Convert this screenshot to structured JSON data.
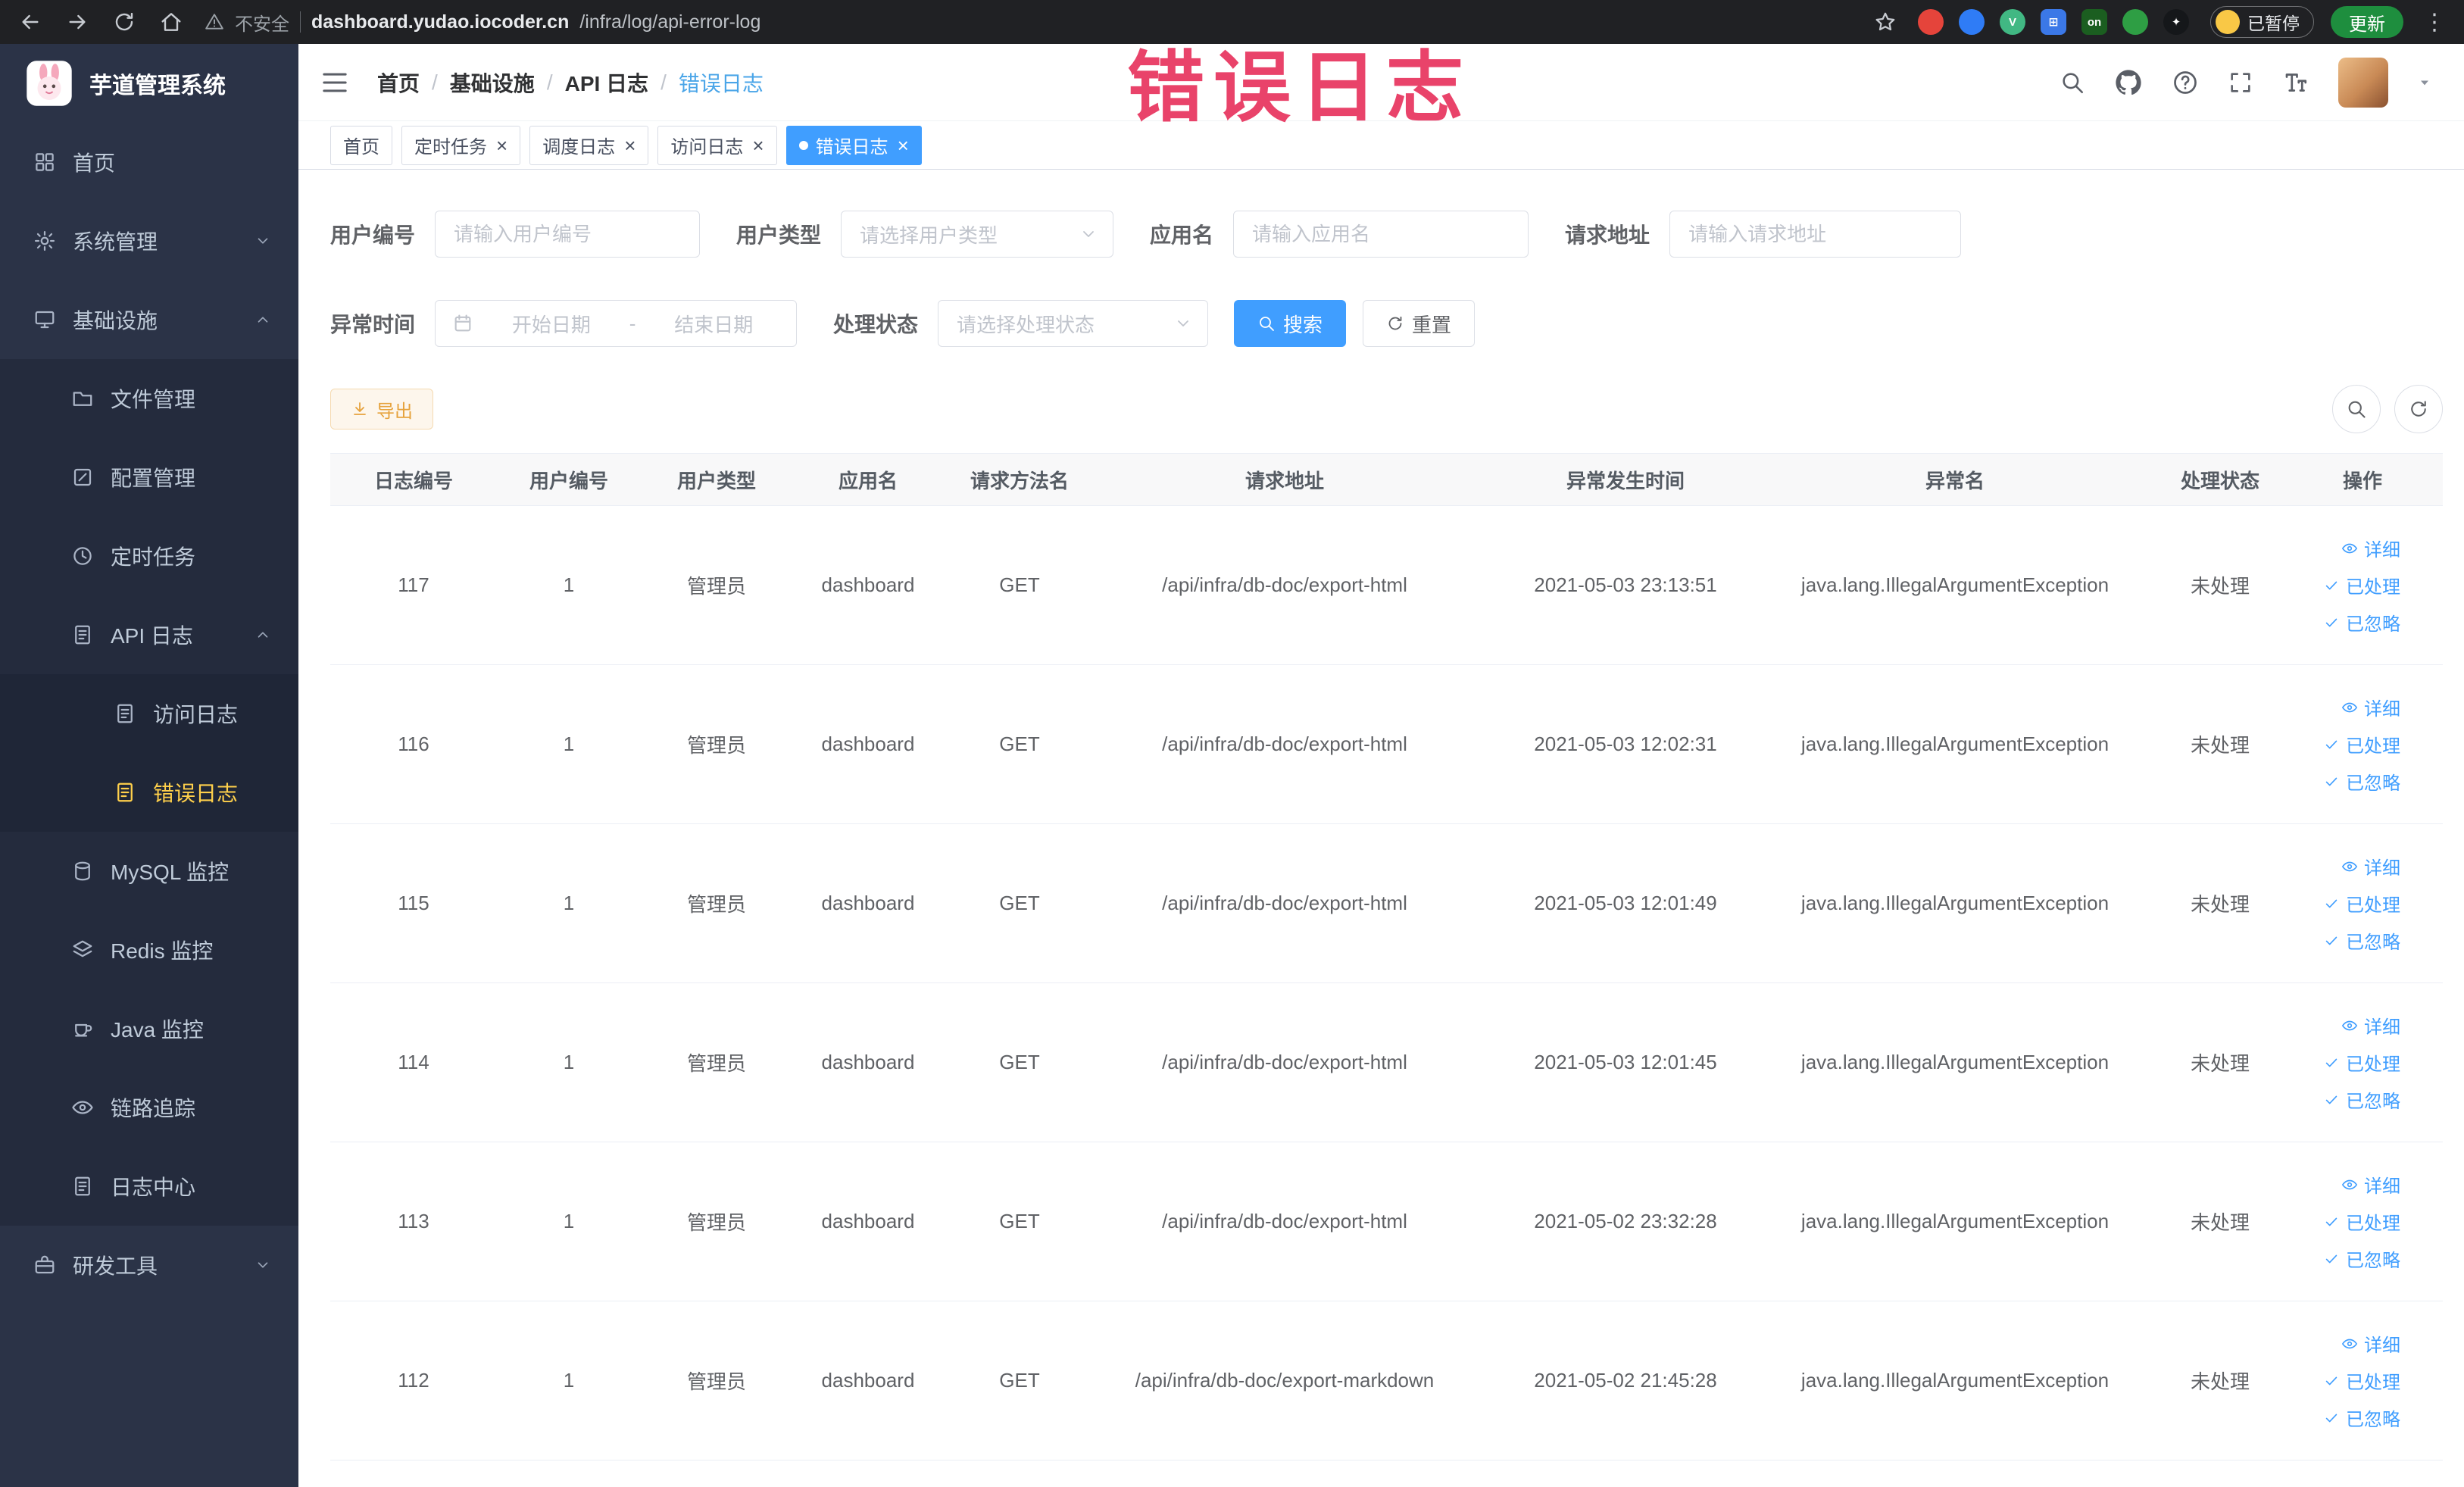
{
  "colors": {
    "accent": "#409eff",
    "link": "#409eff",
    "annotation": "#e8345e",
    "warning": "#e6a23c",
    "sidebar_active": "#ffd04b"
  },
  "annotation": {
    "text": "错误日志"
  },
  "browser": {
    "security_label": "不安全",
    "url_host": "dashboard.yudao.iocoder.cn",
    "url_path": "/infra/log/api-error-log",
    "profile_chip": "已暂停",
    "update_button": "更新",
    "extensions": [
      {
        "name": "record-extension-icon",
        "color": "#e5443b",
        "shape": "circle",
        "glyph": ""
      },
      {
        "name": "water-drop-extension-icon",
        "color": "#2f7cf6",
        "shape": "circle",
        "glyph": ""
      },
      {
        "name": "vue-devtools-extension-icon",
        "color": "#41b883",
        "shape": "circle",
        "glyph": "V"
      },
      {
        "name": "grid-extension-icon",
        "color": "#3b78e7",
        "shape": "square",
        "glyph": "⊞"
      },
      {
        "name": "switch-on-extension-icon",
        "color": "#1b5e20",
        "shape": "square",
        "glyph": "on"
      },
      {
        "name": "leaf-extension-icon",
        "color": "#2e9e44",
        "shape": "circle",
        "glyph": ""
      },
      {
        "name": "pin-extension-icon",
        "color": "#15171a",
        "shape": "circle",
        "glyph": "✦"
      }
    ]
  },
  "sidebar": {
    "logo_title": "芋道管理系统",
    "items": [
      {
        "label": "首页",
        "icon": "dashboard",
        "level": 1
      },
      {
        "label": "系统管理",
        "icon": "gear",
        "level": 1,
        "chevron": "down"
      },
      {
        "label": "基础设施",
        "icon": "infra",
        "level": 1,
        "chevron": "up"
      },
      {
        "label": "文件管理",
        "icon": "folder",
        "level": 2
      },
      {
        "label": "配置管理",
        "icon": "config",
        "level": 2
      },
      {
        "label": "定时任务",
        "icon": "task",
        "level": 2
      },
      {
        "label": "API 日志",
        "icon": "doc",
        "level": 2,
        "chevron": "up"
      },
      {
        "label": "访问日志",
        "icon": "doc",
        "level": 3
      },
      {
        "label": "错误日志",
        "icon": "doc",
        "level": 3,
        "active": true
      },
      {
        "label": "MySQL 监控",
        "icon": "mysql",
        "level": 2
      },
      {
        "label": "Redis 监控",
        "icon": "redis",
        "level": 2
      },
      {
        "label": "Java 监控",
        "icon": "java",
        "level": 2
      },
      {
        "label": "链路追踪",
        "icon": "trace",
        "level": 2
      },
      {
        "label": "日志中心",
        "icon": "doc",
        "level": 2
      },
      {
        "label": "研发工具",
        "icon": "devtools",
        "level": 1,
        "chevron": "down"
      }
    ]
  },
  "header": {
    "breadcrumb": [
      "首页",
      "基础设施",
      "API 日志",
      "错误日志"
    ],
    "separator": "/"
  },
  "tabs": [
    {
      "label": "首页",
      "closable": false,
      "active": false
    },
    {
      "label": "定时任务",
      "closable": true,
      "active": false
    },
    {
      "label": "调度日志",
      "closable": true,
      "active": false
    },
    {
      "label": "访问日志",
      "closable": true,
      "active": false
    },
    {
      "label": "错误日志",
      "closable": true,
      "active": true
    }
  ],
  "filters": {
    "user_id": {
      "label": "用户编号",
      "placeholder": "请输入用户编号"
    },
    "user_type": {
      "label": "用户类型",
      "placeholder": "请选择用户类型"
    },
    "app_name": {
      "label": "应用名",
      "placeholder": "请输入应用名"
    },
    "request_url": {
      "label": "请求地址",
      "placeholder": "请输入请求地址"
    },
    "exception_time": {
      "label": "异常时间",
      "start_placeholder": "开始日期",
      "separator": "-",
      "end_placeholder": "结束日期"
    },
    "process_status": {
      "label": "处理状态",
      "placeholder": "请选择处理状态"
    },
    "search_button": "搜索",
    "reset_button": "重置"
  },
  "toolbar": {
    "export_label": "导出"
  },
  "table": {
    "columns": [
      "日志编号",
      "用户编号",
      "用户类型",
      "应用名",
      "请求方法名",
      "请求地址",
      "异常发生时间",
      "异常名",
      "处理状态",
      "操作"
    ],
    "actions": [
      "详细",
      "已处理",
      "已忽略"
    ],
    "rows": [
      {
        "id": "117",
        "user_id": "1",
        "user_type": "管理员",
        "app": "dashboard",
        "method": "GET",
        "url": "/api/infra/db-doc/export-html",
        "time": "2021-05-03 23:13:51",
        "exception": "java.lang.IllegalArgumentException",
        "status": "未处理"
      },
      {
        "id": "116",
        "user_id": "1",
        "user_type": "管理员",
        "app": "dashboard",
        "method": "GET",
        "url": "/api/infra/db-doc/export-html",
        "time": "2021-05-03 12:02:31",
        "exception": "java.lang.IllegalArgumentException",
        "status": "未处理"
      },
      {
        "id": "115",
        "user_id": "1",
        "user_type": "管理员",
        "app": "dashboard",
        "method": "GET",
        "url": "/api/infra/db-doc/export-html",
        "time": "2021-05-03 12:01:49",
        "exception": "java.lang.IllegalArgumentException",
        "status": "未处理"
      },
      {
        "id": "114",
        "user_id": "1",
        "user_type": "管理员",
        "app": "dashboard",
        "method": "GET",
        "url": "/api/infra/db-doc/export-html",
        "time": "2021-05-03 12:01:45",
        "exception": "java.lang.IllegalArgumentException",
        "status": "未处理"
      },
      {
        "id": "113",
        "user_id": "1",
        "user_type": "管理员",
        "app": "dashboard",
        "method": "GET",
        "url": "/api/infra/db-doc/export-html",
        "time": "2021-05-02 23:32:28",
        "exception": "java.lang.IllegalArgumentException",
        "status": "未处理"
      },
      {
        "id": "112",
        "user_id": "1",
        "user_type": "管理员",
        "app": "dashboard",
        "method": "GET",
        "url": "/api/infra/db-doc/export-markdown",
        "time": "2021-05-02 21:45:28",
        "exception": "java.lang.IllegalArgumentException",
        "status": "未处理"
      }
    ]
  }
}
